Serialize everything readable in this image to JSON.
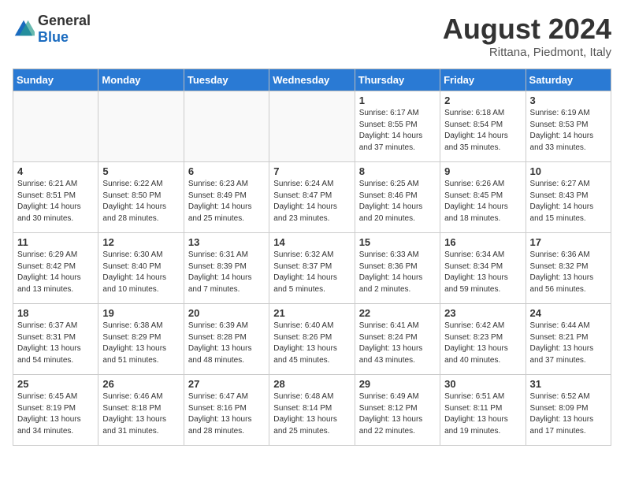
{
  "header": {
    "logo_general": "General",
    "logo_blue": "Blue",
    "title": "August 2024",
    "subtitle": "Rittana, Piedmont, Italy"
  },
  "days_of_week": [
    "Sunday",
    "Monday",
    "Tuesday",
    "Wednesday",
    "Thursday",
    "Friday",
    "Saturday"
  ],
  "weeks": [
    [
      {
        "day": "",
        "info": ""
      },
      {
        "day": "",
        "info": ""
      },
      {
        "day": "",
        "info": ""
      },
      {
        "day": "",
        "info": ""
      },
      {
        "day": "1",
        "info": "Sunrise: 6:17 AM\nSunset: 8:55 PM\nDaylight: 14 hours\nand 37 minutes."
      },
      {
        "day": "2",
        "info": "Sunrise: 6:18 AM\nSunset: 8:54 PM\nDaylight: 14 hours\nand 35 minutes."
      },
      {
        "day": "3",
        "info": "Sunrise: 6:19 AM\nSunset: 8:53 PM\nDaylight: 14 hours\nand 33 minutes."
      }
    ],
    [
      {
        "day": "4",
        "info": "Sunrise: 6:21 AM\nSunset: 8:51 PM\nDaylight: 14 hours\nand 30 minutes."
      },
      {
        "day": "5",
        "info": "Sunrise: 6:22 AM\nSunset: 8:50 PM\nDaylight: 14 hours\nand 28 minutes."
      },
      {
        "day": "6",
        "info": "Sunrise: 6:23 AM\nSunset: 8:49 PM\nDaylight: 14 hours\nand 25 minutes."
      },
      {
        "day": "7",
        "info": "Sunrise: 6:24 AM\nSunset: 8:47 PM\nDaylight: 14 hours\nand 23 minutes."
      },
      {
        "day": "8",
        "info": "Sunrise: 6:25 AM\nSunset: 8:46 PM\nDaylight: 14 hours\nand 20 minutes."
      },
      {
        "day": "9",
        "info": "Sunrise: 6:26 AM\nSunset: 8:45 PM\nDaylight: 14 hours\nand 18 minutes."
      },
      {
        "day": "10",
        "info": "Sunrise: 6:27 AM\nSunset: 8:43 PM\nDaylight: 14 hours\nand 15 minutes."
      }
    ],
    [
      {
        "day": "11",
        "info": "Sunrise: 6:29 AM\nSunset: 8:42 PM\nDaylight: 14 hours\nand 13 minutes."
      },
      {
        "day": "12",
        "info": "Sunrise: 6:30 AM\nSunset: 8:40 PM\nDaylight: 14 hours\nand 10 minutes."
      },
      {
        "day": "13",
        "info": "Sunrise: 6:31 AM\nSunset: 8:39 PM\nDaylight: 14 hours\nand 7 minutes."
      },
      {
        "day": "14",
        "info": "Sunrise: 6:32 AM\nSunset: 8:37 PM\nDaylight: 14 hours\nand 5 minutes."
      },
      {
        "day": "15",
        "info": "Sunrise: 6:33 AM\nSunset: 8:36 PM\nDaylight: 14 hours\nand 2 minutes."
      },
      {
        "day": "16",
        "info": "Sunrise: 6:34 AM\nSunset: 8:34 PM\nDaylight: 13 hours\nand 59 minutes."
      },
      {
        "day": "17",
        "info": "Sunrise: 6:36 AM\nSunset: 8:32 PM\nDaylight: 13 hours\nand 56 minutes."
      }
    ],
    [
      {
        "day": "18",
        "info": "Sunrise: 6:37 AM\nSunset: 8:31 PM\nDaylight: 13 hours\nand 54 minutes."
      },
      {
        "day": "19",
        "info": "Sunrise: 6:38 AM\nSunset: 8:29 PM\nDaylight: 13 hours\nand 51 minutes."
      },
      {
        "day": "20",
        "info": "Sunrise: 6:39 AM\nSunset: 8:28 PM\nDaylight: 13 hours\nand 48 minutes."
      },
      {
        "day": "21",
        "info": "Sunrise: 6:40 AM\nSunset: 8:26 PM\nDaylight: 13 hours\nand 45 minutes."
      },
      {
        "day": "22",
        "info": "Sunrise: 6:41 AM\nSunset: 8:24 PM\nDaylight: 13 hours\nand 43 minutes."
      },
      {
        "day": "23",
        "info": "Sunrise: 6:42 AM\nSunset: 8:23 PM\nDaylight: 13 hours\nand 40 minutes."
      },
      {
        "day": "24",
        "info": "Sunrise: 6:44 AM\nSunset: 8:21 PM\nDaylight: 13 hours\nand 37 minutes."
      }
    ],
    [
      {
        "day": "25",
        "info": "Sunrise: 6:45 AM\nSunset: 8:19 PM\nDaylight: 13 hours\nand 34 minutes."
      },
      {
        "day": "26",
        "info": "Sunrise: 6:46 AM\nSunset: 8:18 PM\nDaylight: 13 hours\nand 31 minutes."
      },
      {
        "day": "27",
        "info": "Sunrise: 6:47 AM\nSunset: 8:16 PM\nDaylight: 13 hours\nand 28 minutes."
      },
      {
        "day": "28",
        "info": "Sunrise: 6:48 AM\nSunset: 8:14 PM\nDaylight: 13 hours\nand 25 minutes."
      },
      {
        "day": "29",
        "info": "Sunrise: 6:49 AM\nSunset: 8:12 PM\nDaylight: 13 hours\nand 22 minutes."
      },
      {
        "day": "30",
        "info": "Sunrise: 6:51 AM\nSunset: 8:11 PM\nDaylight: 13 hours\nand 19 minutes."
      },
      {
        "day": "31",
        "info": "Sunrise: 6:52 AM\nSunset: 8:09 PM\nDaylight: 13 hours\nand 17 minutes."
      }
    ]
  ]
}
